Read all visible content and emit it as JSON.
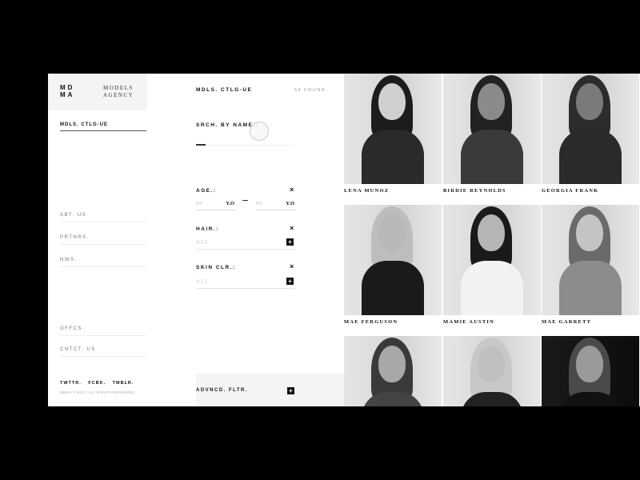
{
  "brand": {
    "mark_line1": "MD",
    "mark_line2": "MA",
    "name_line1": "MODELS",
    "name_line2": "AGENCY"
  },
  "sidebar": {
    "active_item": "MDLS. CTLG-UE",
    "items": [
      {
        "label": "ABT. US"
      },
      {
        "label": "PRTNRS."
      },
      {
        "label": "NWS."
      },
      {
        "label": "OFFCS."
      },
      {
        "label": "CNTCT. US"
      }
    ],
    "social": [
      "TWTTR.",
      "FCBK.",
      "TMBLR."
    ],
    "copyright": "MMDA © 2017. ALL RIGHTS RESERVED."
  },
  "filters": {
    "title": "MDLS. CTLG-UE",
    "count": "59 FOUND",
    "search_label": "SRCH. BY NAME.:",
    "search_value": "",
    "age": {
      "label": "AGE.:",
      "from_placeholder": "00",
      "to_placeholder": "00",
      "unit": "Y.O"
    },
    "hair": {
      "label": "HAIR.:",
      "value": "ALL"
    },
    "skin": {
      "label": "SKIN CLR.:",
      "value": "ALL"
    },
    "clear_icon": "×",
    "add_icon": "+",
    "advanced_label": "ADVNCD. FLTR."
  },
  "models": [
    {
      "name": "LENA MUNOZ",
      "tone": "light-bg",
      "hair": "#1c1c1c",
      "top": "#2a2a2a",
      "skin": "#cfcfcf"
    },
    {
      "name": "BIRDIE REYNOLDS",
      "tone": "light-bg",
      "hair": "#222",
      "top": "#3a3a3a",
      "skin": "#8a8a8a"
    },
    {
      "name": "GEORGIA FRANK",
      "tone": "light-bg",
      "hair": "#2c2c2c",
      "top": "#2a2a2a",
      "skin": "#7a7a7a"
    },
    {
      "name": "MAE FERGUSON",
      "tone": "light-bg",
      "hair": "#bdbdbd",
      "top": "#1a1a1a",
      "skin": "#b8b8b8"
    },
    {
      "name": "MAMIE AUSTIN",
      "tone": "light-bg",
      "hair": "#1a1a1a",
      "top": "#f2f2f2",
      "skin": "#b5b5b5"
    },
    {
      "name": "MAE GARRETT",
      "tone": "light-bg",
      "hair": "#6a6a6a",
      "top": "#8c8c8c",
      "skin": "#c4c4c4"
    },
    {
      "name": "",
      "tone": "light-bg",
      "hair": "#3a3a3a",
      "top": "#444",
      "skin": "#a8a8a8"
    },
    {
      "name": "",
      "tone": "light-bg",
      "hair": "#c8c8c8",
      "top": "#222",
      "skin": "#c0c0c0"
    },
    {
      "name": "",
      "tone": "dark-bg",
      "hair": "#4a4a4a",
      "top": "#111",
      "skin": "#9a9a9a"
    }
  ]
}
